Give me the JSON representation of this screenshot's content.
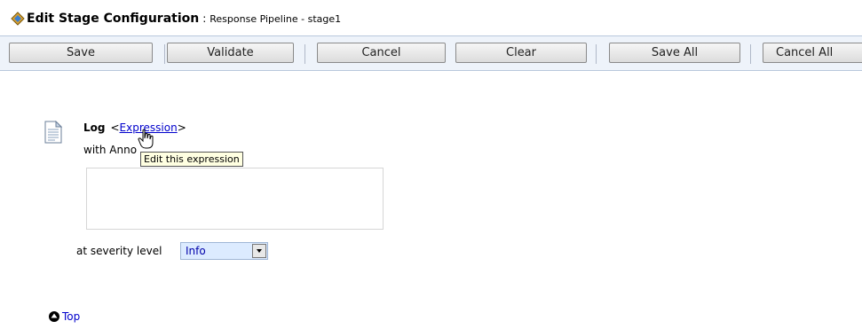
{
  "header": {
    "title": "Edit Stage Configuration",
    "separator": ":",
    "subtitle": "Response Pipeline - stage1",
    "icon": "stage-icon"
  },
  "toolbar": {
    "buttons": [
      {
        "label": "Save"
      },
      {
        "label": "Validate"
      },
      {
        "label": "Cancel"
      },
      {
        "label": "Clear"
      },
      {
        "label": "Save All"
      },
      {
        "label": "Cancel All"
      }
    ]
  },
  "action": {
    "icon": "document-icon",
    "label": "Log",
    "expr_open": "<",
    "expr_text": "Expression",
    "expr_close": ">",
    "annotation_label": "with Anno",
    "tooltip": "Edit this expression",
    "annotation_value": "",
    "severity_label": "at severity level",
    "severity_value": "Info"
  },
  "footer": {
    "top_label": "Top",
    "top_icon": "up-arrow-circle-icon"
  },
  "colors": {
    "link": "#0000cc",
    "toolbar_bg": "#eef3fa",
    "select_bg": "#dcebff",
    "tooltip_bg": "#ffffe1"
  }
}
